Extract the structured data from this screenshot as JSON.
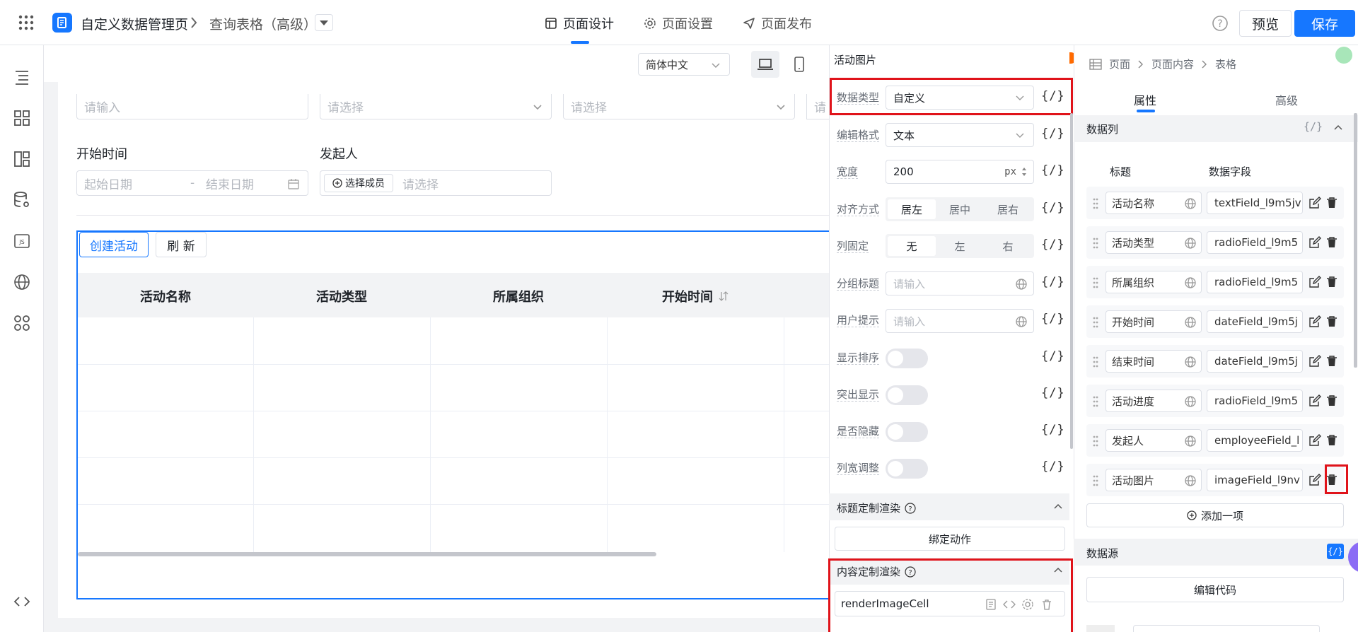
{
  "header": {
    "app_title": "自定义数据管理页",
    "breadcrumb_page": "查询表格（高级）",
    "tabs": [
      {
        "label": "页面设计",
        "active": true
      },
      {
        "label": "页面设置",
        "active": false
      },
      {
        "label": "页面发布",
        "active": false
      }
    ],
    "preview_label": "预览",
    "save_label": "保存",
    "accent": "#1677ff"
  },
  "canvas_toolbar": {
    "language": "简体中文"
  },
  "filters": {
    "input1_placeholder": "请输入",
    "select1_placeholder": "请选择",
    "select2_placeholder": "请选择",
    "select3_placeholder": "请",
    "start_time_label": "开始时间",
    "start_date_placeholder": "起始日期",
    "range_sep": "-",
    "end_date_placeholder": "结束日期",
    "initiator_label": "发起人",
    "choose_member_label": "选择成员",
    "initiator_placeholder": "请选择"
  },
  "table_toolbar": {
    "create_label": "创建活动",
    "refresh_label": "刷 新"
  },
  "table": {
    "headers": [
      "活动名称",
      "活动类型",
      "所属组织",
      "开始时间"
    ]
  },
  "column_props": {
    "title": "活动图片",
    "rows": {
      "data_type": {
        "label": "数据类型",
        "value": "自定义"
      },
      "edit_format": {
        "label": "编辑格式",
        "value": "文本"
      },
      "width": {
        "label": "宽度",
        "value": "200",
        "unit": "px"
      },
      "align": {
        "label": "对齐方式",
        "options": [
          "居左",
          "居中",
          "居右"
        ],
        "selected": "居左"
      },
      "fixed": {
        "label": "列固定",
        "options": [
          "无",
          "左",
          "右"
        ],
        "selected": "无"
      },
      "group_title": {
        "label": "分组标题",
        "placeholder": "请输入"
      },
      "user_tip": {
        "label": "用户提示",
        "placeholder": "请输入"
      },
      "show_sort": {
        "label": "显示排序",
        "on": false
      },
      "highlight": {
        "label": "突出显示",
        "on": false
      },
      "hidden": {
        "label": "是否隐藏",
        "on": false
      },
      "resizable": {
        "label": "列宽调整",
        "on": false
      }
    },
    "fx_label": "{/}",
    "title_render": {
      "label": "标题定制渲染",
      "bind_action_label": "绑定动作"
    },
    "content_render": {
      "label": "内容定制渲染",
      "function_name": "renderImageCell"
    }
  },
  "right_panel": {
    "breadcrumb": [
      "页面",
      "页面内容",
      "表格"
    ],
    "tabs": [
      {
        "label": "属性",
        "active": true
      },
      {
        "label": "高级",
        "active": false
      }
    ],
    "data_columns": {
      "title": "数据列",
      "fx_label": "{/}",
      "col_title_header": "标题",
      "col_field_header": "数据字段",
      "items": [
        {
          "title": "活动名称",
          "field": "textField_l9m5jv"
        },
        {
          "title": "活动类型",
          "field": "radioField_l9m5"
        },
        {
          "title": "所属组织",
          "field": "radioField_l9m5"
        },
        {
          "title": "开始时间",
          "field": "dateField_l9m5j"
        },
        {
          "title": "结束时间",
          "field": "dateField_l9m5j"
        },
        {
          "title": "活动进度",
          "field": "radioField_l9m5"
        },
        {
          "title": "发起人",
          "field": "employeeField_l"
        },
        {
          "title": "活动图片",
          "field": "imageField_l9nv"
        }
      ],
      "add_item_label": "添加一项"
    },
    "data_source": {
      "title": "数据源",
      "fx_label": "{/}",
      "edit_code_label": "编辑代码"
    }
  }
}
